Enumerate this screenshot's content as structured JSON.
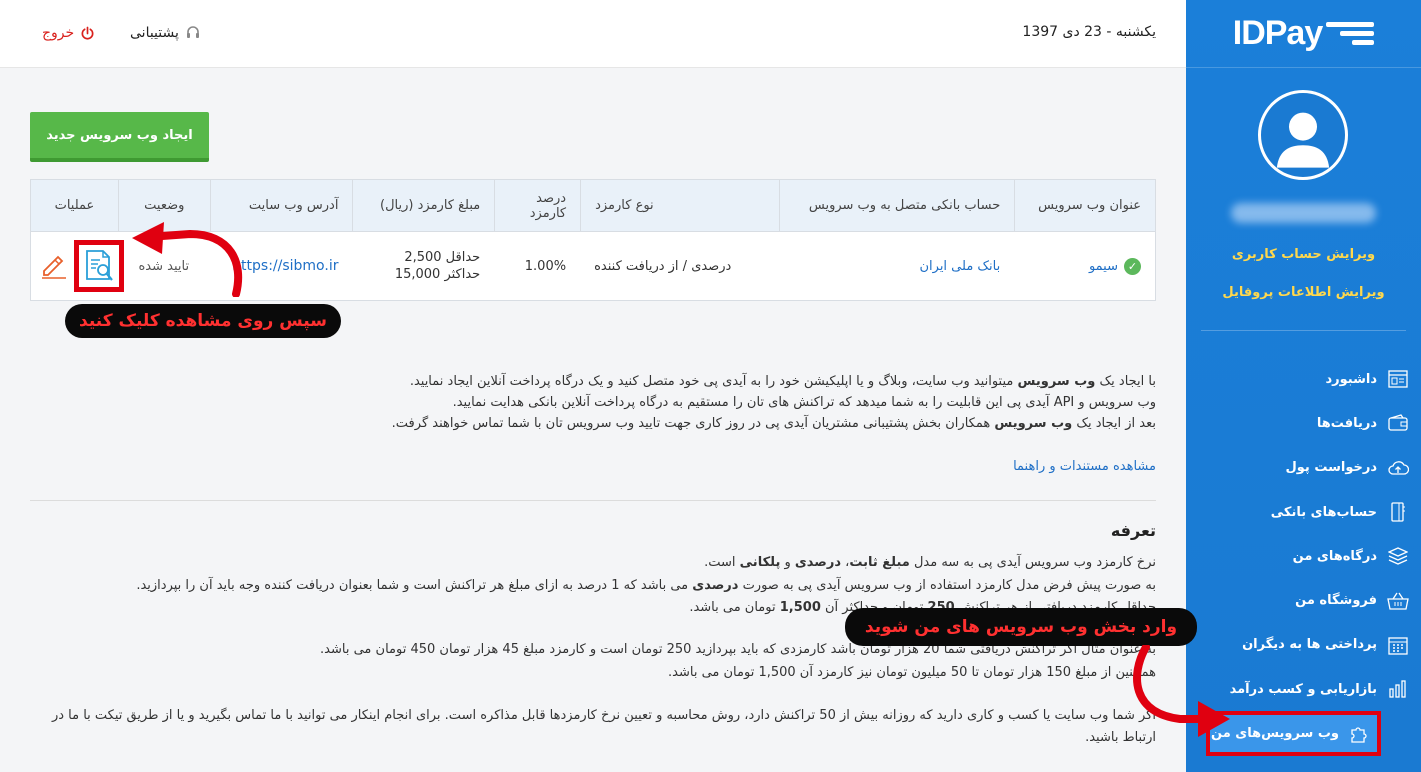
{
  "header": {
    "date": "یکشنبه - 23 دی 1397",
    "support_label": "پشتیبانی",
    "logout_label": "خروج"
  },
  "sidebar": {
    "logo_text": "IDPay",
    "edit_account": "ویرایش حساب کاربری",
    "edit_profile": "ویرایش اطلاعات پروفایل",
    "items": [
      {
        "label": "داشبورد",
        "icon": "dashboard-icon"
      },
      {
        "label": "دریافت‌ها",
        "icon": "wallet-icon"
      },
      {
        "label": "درخواست پول",
        "icon": "cloud-icon"
      },
      {
        "label": "حساب‌های بانکی",
        "icon": "bank-card-icon"
      },
      {
        "label": "درگاه‌های من",
        "icon": "layers-icon"
      },
      {
        "label": "فروشگاه من",
        "icon": "basket-icon"
      },
      {
        "label": "پرداختی ها به دیگران",
        "icon": "calendar-icon"
      },
      {
        "label": "بازاریابی و کسب درآمد",
        "icon": "bar-chart-icon"
      },
      {
        "label": "وب سرویس‌های من",
        "icon": "puzzle-icon",
        "active": true
      }
    ]
  },
  "new_button": "ایجاد وب سرویس جدید",
  "table": {
    "headers": [
      "عنوان وب سرویس",
      "حساب بانکی متصل به وب سرویس",
      "نوع کارمزد",
      "درصد کارمزد",
      "مبلغ کارمزد (ریال)",
      "آدرس وب سایت",
      "وضعیت",
      "عملیات"
    ],
    "row": {
      "title": "سیمو",
      "bank": "بانک ملی ایران",
      "fee_type": "درصدی / از دریافت کننده",
      "fee_percent": "1.00%",
      "fee_min": "حداقل 2,500",
      "fee_max": "حداکثر 15,000",
      "website": "https://sibmo.ir",
      "status": "تایید شده"
    }
  },
  "callouts": {
    "view": "سپس روی مشاهده کلیک کنید",
    "section": "وارد بخش وب سرویس های من شوید"
  },
  "description": {
    "line1_pre": "با ایجاد یک ",
    "line1_bold": "وب سرویس",
    "line1_post": " میتوانید وب سایت، وبلاگ و یا اپلیکیشن خود را به آیدی پی خود متصل کنید و یک درگاه پرداخت آنلاین ایجاد نمایید.",
    "line2": "وب سرویس و API آیدی پی این قابلیت را به شما میدهد که تراکنش های تان را مستقیم به درگاه پرداخت آنلاین بانکی هدایت نمایید.",
    "line3_pre": "بعد از ایجاد یک ",
    "line3_bold": "وب سرویس",
    "line3_post": " همکاران بخش پشتیبانی مشتریان آیدی پی در روز کاری جهت تایید وب سرویس تان با شما تماس خواهند گرفت.",
    "docs_link": "مشاهده مستندات و راهنما"
  },
  "tariff": {
    "heading": "تعرفه",
    "p1_pre": "نرخ کارمزد وب سرویس آیدی پی به سه مدل ",
    "p1_bold1": "مبلغ ثابت",
    "p1_sep1": "، ",
    "p1_bold2": "درصدی",
    "p1_sep2": " و ",
    "p1_bold3": "پلکانی",
    "p1_post": " است.",
    "p2_pre": "به صورت پیش فرض مدل کارمزد استفاده از وب سرویس آیدی پی به صورت ",
    "p2_bold": "درصدی",
    "p2_post": " می باشد که 1 درصد به ازای مبلغ هر تراکنش است و شما بعنوان دریافت کننده وجه باید آن را بپردازید.",
    "p3_pre": "حداقل کارمزد دریافتی از هر تراکنش ",
    "p3_bold1": "250",
    "p3_mid": " تومان و حداکثر آن ",
    "p3_bold2": "1,500",
    "p3_post": " تومان می باشد.",
    "p4": "به عنوان مثال اگر تراکنش دریافتی شما 20 هزار تومان باشد کارمزدی که باید بپردازید 250 تومان است و کارمزد مبلغ 45 هزار تومان 450 تومان می باشد.",
    "p5": "همچنین از مبلغ 150 هزار تومان تا 50 میلیون تومان نیز کارمزد آن 1,500 تومان می باشد.",
    "p6": "اگر شما وب سایت یا کسب و کاری دارید که روزانه بیش از 50 تراکنش دارد، روش محاسبه و تعیین نرخ کارمزدها قابل مذاکره است. برای انجام اینکار می توانید با ما تماس بگیرید و یا از طریق تیکت با ما در",
    "p7": "ارتباط باشید."
  }
}
